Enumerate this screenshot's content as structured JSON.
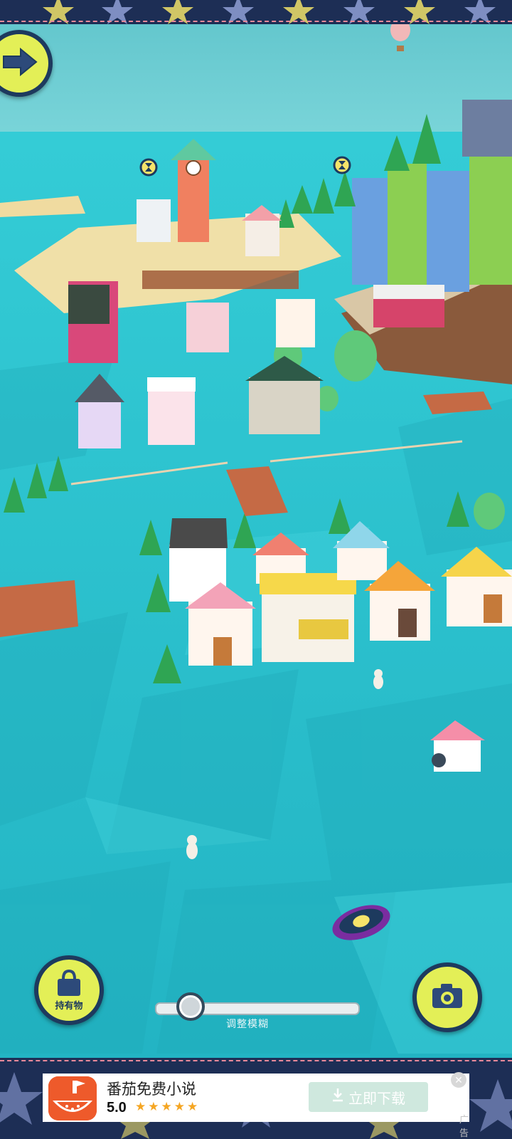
{
  "scene": {
    "sea_color": "#2cc4cf",
    "sky_color": "#6fd2d7",
    "description_icons": [
      "hourglass-marker",
      "hourglass-marker",
      "coin-portal"
    ]
  },
  "controls": {
    "back_icon": "arrow-right-icon",
    "inventory_label": "持有物",
    "inventory_icon": "bag-icon",
    "camera_icon": "camera-icon",
    "blur_slider_label": "调整模糊",
    "blur_slider_value": 0.17
  },
  "ad": {
    "app_name": "番茄免费小说",
    "rating": "5.0",
    "stars": "★★★★★",
    "download_label": "立即下载",
    "download_icon": "download-icon",
    "close_icon": "close-icon",
    "ad_tag": "广告",
    "accent": "#ee5a2b"
  }
}
